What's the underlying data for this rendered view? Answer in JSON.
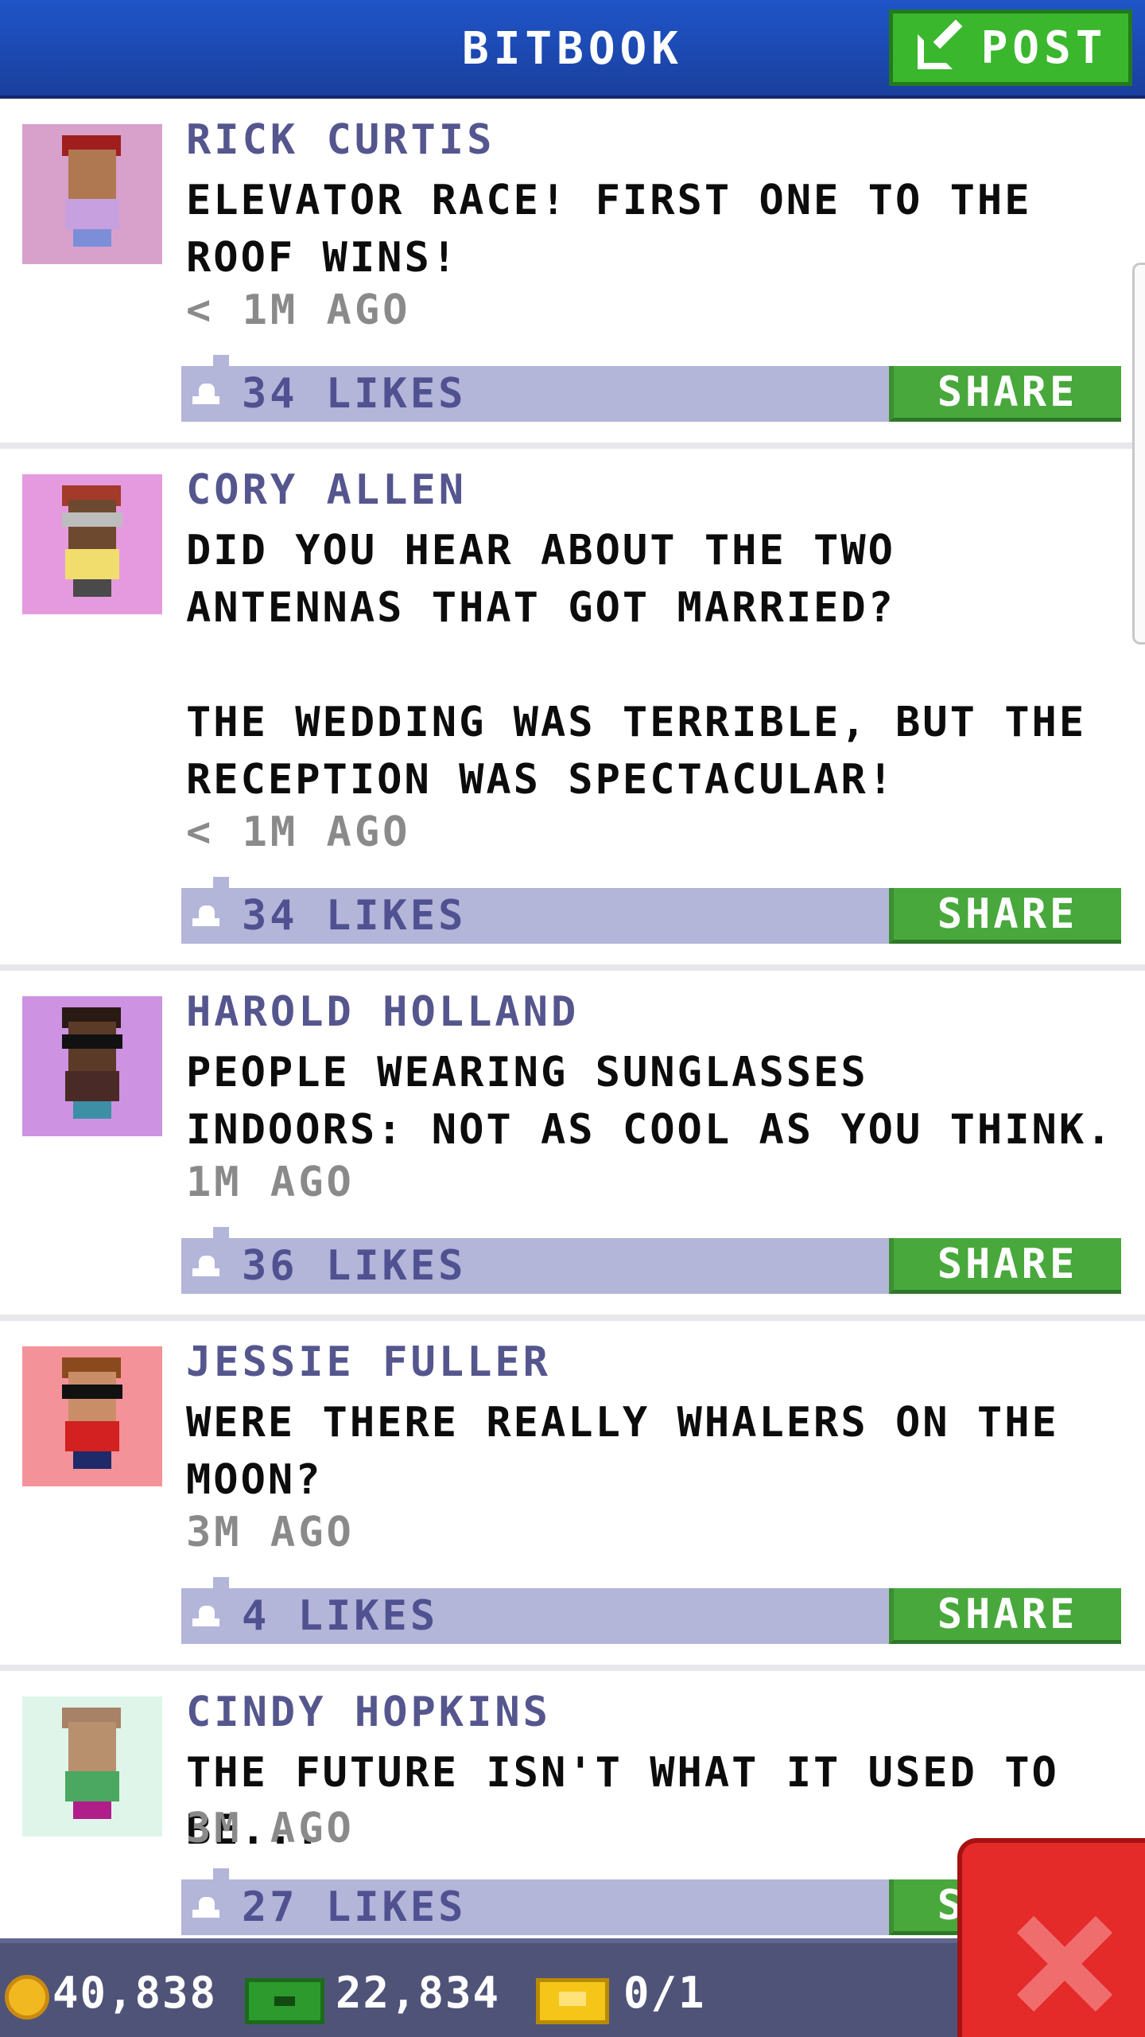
{
  "header": {
    "title": "BITBOOK",
    "post_label": "POST",
    "post_icon": "edit-icon"
  },
  "posts": [
    {
      "author": "RICK CURTIS",
      "message": "ELEVATOR RACE! FIRST ONE TO THE\nROOF WINS!",
      "time": "< 1M AGO",
      "likes": "34 LIKES",
      "share_label": "SHARE",
      "avatar_bg": "#d7a1cc",
      "avatar": {
        "hat": "#a11e1e",
        "skin": "#b07850",
        "shirt": "#c7a0e0",
        "legs": "#7c8ed8"
      }
    },
    {
      "author": "CORY ALLEN",
      "message": "DID YOU HEAR ABOUT THE TWO\nANTENNAS THAT GOT MARRIED?\n\nTHE WEDDING WAS TERRIBLE, BUT THE\nRECEPTION WAS SPECTACULAR!",
      "time": "< 1M AGO",
      "likes": "34 LIKES",
      "share_label": "SHARE",
      "avatar_bg": "#e59adf",
      "avatar": {
        "hat": "#a33a2a",
        "skin": "#6d4a2f",
        "shirt": "#f0dd6e",
        "legs": "#4a4a4a"
      }
    },
    {
      "author": "HAROLD HOLLAND",
      "message": "PEOPLE WEARING SUNGLASSES\nINDOORS: NOT AS COOL AS YOU THINK.",
      "time": "1M AGO",
      "likes": "36 LIKES",
      "share_label": "SHARE",
      "avatar_bg": "#cd92e2",
      "avatar": {
        "hat": "#2a1a14",
        "skin": "#5b3a28",
        "shirt": "#4a2a26",
        "legs": "#3d8fa6"
      }
    },
    {
      "author": "JESSIE FULLER",
      "message": "WERE THERE REALLY WHALERS ON THE\nMOON?",
      "time": "3M AGO",
      "likes": "4 LIKES",
      "share_label": "SHARE",
      "avatar_bg": "#f4929a",
      "avatar": {
        "hat": "#8a4a1e",
        "skin": "#c98e68",
        "shirt": "#d32020",
        "legs": "#1e2a6a"
      }
    },
    {
      "author": "CINDY HOPKINS",
      "message": "THE FUTURE ISN'T WHAT IT USED TO BE...",
      "time": "3M AGO",
      "likes": "27 LIKES",
      "share_label": "SHARE",
      "avatar_bg": "#dff5ea",
      "avatar": {
        "hat": "#a88266",
        "skin": "#b8906e",
        "shirt": "#4aa860",
        "legs": "#b01e8a"
      }
    }
  ],
  "status": {
    "coins": "40,838",
    "bux": "22,834",
    "vip": "0/1",
    "coin_icon": "coin-icon",
    "bux_icon": "bux-icon",
    "vip_icon": "vip-ticket-icon"
  },
  "close_icon": "close-icon",
  "colors": {
    "header": "#1f55c8",
    "post_button": "#3ab72d",
    "share_button": "#48a83c",
    "likes_bar": "#b3b5d9",
    "author": "#55568e",
    "close_button": "#e52a2a",
    "status_bar": "#505378"
  }
}
